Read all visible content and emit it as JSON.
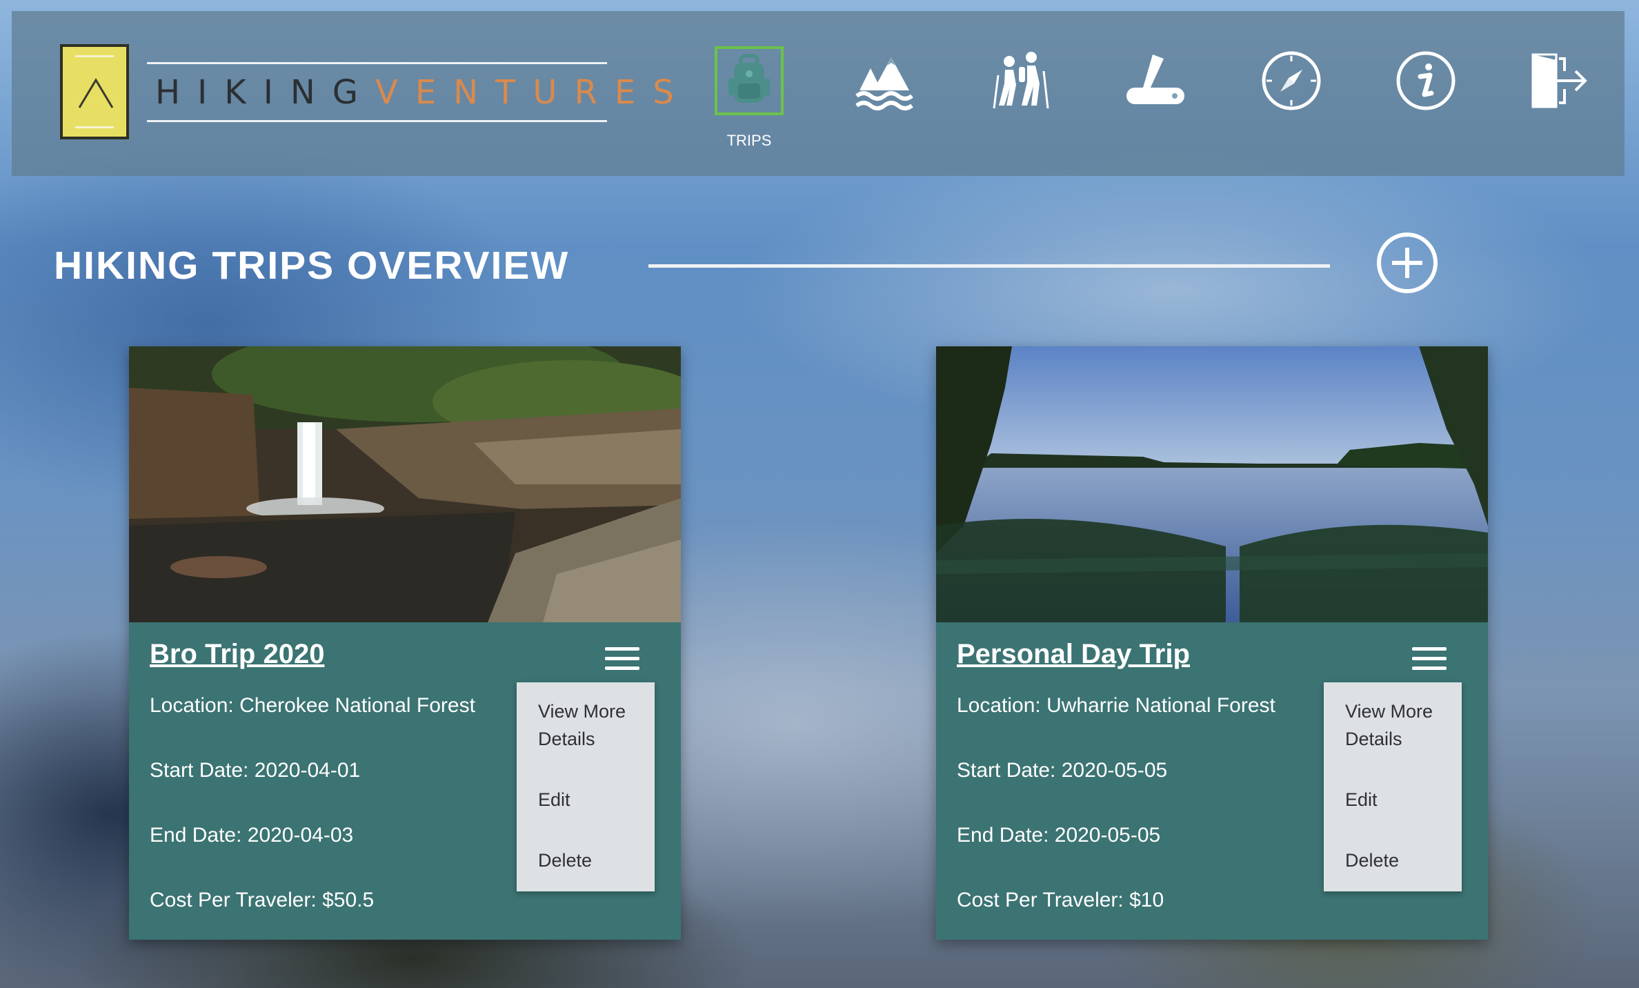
{
  "header": {
    "brand_part1": "HIKING",
    "brand_part2": "VENTURES",
    "nav": [
      {
        "icon": "backpack-icon",
        "label": "TRIPS",
        "active": true
      },
      {
        "icon": "mountain-lake-icon",
        "label": ""
      },
      {
        "icon": "hikers-icon",
        "label": ""
      },
      {
        "icon": "pocket-knife-icon",
        "label": ""
      },
      {
        "icon": "compass-icon",
        "label": ""
      },
      {
        "icon": "info-icon",
        "label": ""
      },
      {
        "icon": "logout-icon",
        "label": ""
      }
    ]
  },
  "page": {
    "title": "HIKING TRIPS OVERVIEW",
    "add_icon": "plus-circle-icon"
  },
  "trips": [
    {
      "name": "Bro Trip 2020",
      "location": "Location: Cherokee National Forest",
      "start_date": "Start Date: 2020-04-01",
      "end_date": "End Date: 2020-04-03",
      "cost": "Cost Per Traveler: $50.5",
      "menu": [
        "View More Details",
        "Edit",
        "Delete"
      ]
    },
    {
      "name": "Personal Day Trip",
      "location": "Location: Uwharrie National Forest",
      "start_date": "Start Date: 2020-05-05",
      "end_date": "End Date: 2020-05-05",
      "cost": "Cost Per Traveler: $10",
      "menu": [
        "View More Details",
        "Edit",
        "Delete"
      ]
    }
  ],
  "colors": {
    "accent_orange": "#d98a4d",
    "logo_yellow": "#e7df63",
    "active_green": "#6cc24a",
    "card_teal": "#447a7a"
  }
}
